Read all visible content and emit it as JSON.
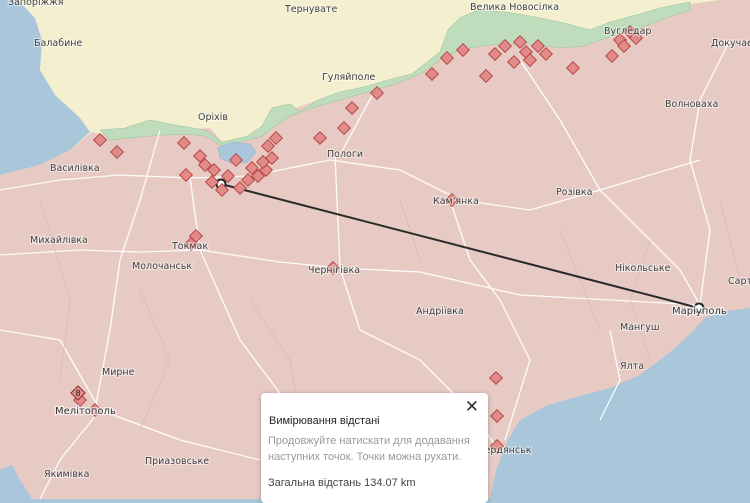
{
  "map": {
    "colors": {
      "water": "#a9c6db",
      "land": "#f4f0cf",
      "occupied": "#e7cac3",
      "front_green": "#bfdcbd",
      "reservoir": "#a9c6db",
      "roads": "#ffffff",
      "measure_line": "#2b2a2a",
      "strike_fill": "#e28a88",
      "strike_stroke": "#b3413f"
    },
    "labels": [
      "Запоріжжя",
      "Тернувате",
      "Велика Новосілка",
      "Балабине",
      "Вугледар",
      "Докучаєве",
      "Гуляйполе",
      "Оріхів",
      "Волноваха",
      "Пологи",
      "Василівка",
      "Розівка",
      "Кам'янка",
      "Михайлівка",
      "Токмак",
      "Молочанськ",
      "Чернігівка",
      "Нікольське",
      "Сартана",
      "Андріївка",
      "Маріуполь",
      "Мангуш",
      "Мирне",
      "Ялта",
      "Мелітополь",
      "Приазовське",
      "Бердянськ",
      "Якимівка"
    ],
    "measure": {
      "points": [
        "start",
        "end"
      ]
    },
    "strike_markers": "red-diamond-icon",
    "cluster_badge": "8"
  },
  "panel": {
    "title": "Вимірювання відстані",
    "hint": "Продовжуйте натискати для додавання наступних точок. Точки можна рухати.",
    "total_label": "Загальна відстань 134.07 km",
    "close_icon": "close-icon"
  }
}
